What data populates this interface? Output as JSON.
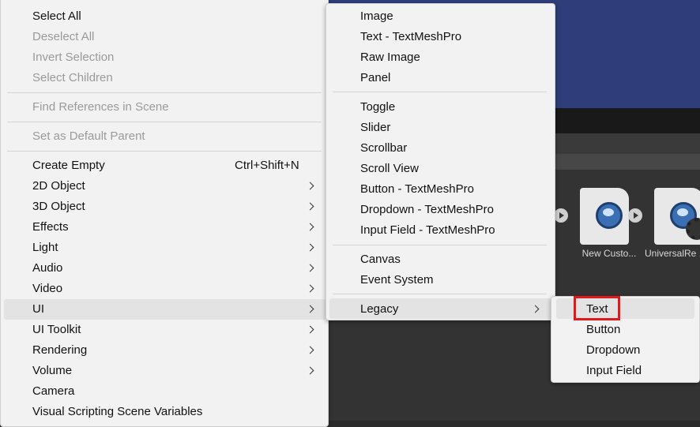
{
  "background": {
    "assets": [
      {
        "name": "New Custo...",
        "icon": "custom-render-asset-icon"
      },
      {
        "name": "UniversalRe",
        "icon": "universal-render-settings-icon"
      }
    ]
  },
  "context_menu": {
    "items": [
      {
        "label": "Select All",
        "enabled": true
      },
      {
        "label": "Deselect All",
        "enabled": false
      },
      {
        "label": "Invert Selection",
        "enabled": false
      },
      {
        "label": "Select Children",
        "enabled": false
      },
      {
        "label": "Find References in Scene",
        "enabled": false
      },
      {
        "label": "Set as Default Parent",
        "enabled": false
      },
      {
        "label": "Create Empty",
        "shortcut": "Ctrl+Shift+N",
        "enabled": true
      },
      {
        "label": "2D Object",
        "submenu": true
      },
      {
        "label": "3D Object",
        "submenu": true
      },
      {
        "label": "Effects",
        "submenu": true
      },
      {
        "label": "Light",
        "submenu": true
      },
      {
        "label": "Audio",
        "submenu": true
      },
      {
        "label": "Video",
        "submenu": true
      },
      {
        "label": "UI",
        "submenu": true,
        "highlighted": true
      },
      {
        "label": "UI Toolkit",
        "submenu": true
      },
      {
        "label": "Rendering",
        "submenu": true
      },
      {
        "label": "Volume",
        "submenu": true
      },
      {
        "label": "Camera"
      },
      {
        "label": "Visual Scripting Scene Variables"
      }
    ]
  },
  "ui_submenu": {
    "items": [
      {
        "label": "Image"
      },
      {
        "label": "Text - TextMeshPro"
      },
      {
        "label": "Raw Image"
      },
      {
        "label": "Panel"
      },
      {
        "label": "Toggle"
      },
      {
        "label": "Slider"
      },
      {
        "label": "Scrollbar"
      },
      {
        "label": "Scroll View"
      },
      {
        "label": "Button - TextMeshPro"
      },
      {
        "label": "Dropdown - TextMeshPro"
      },
      {
        "label": "Input Field - TextMeshPro"
      },
      {
        "label": "Canvas"
      },
      {
        "label": "Event System"
      },
      {
        "label": "Legacy",
        "submenu": true,
        "highlighted": true
      }
    ]
  },
  "legacy_submenu": {
    "items": [
      {
        "label": "Text",
        "highlighted": true,
        "annotated": true
      },
      {
        "label": "Button"
      },
      {
        "label": "Dropdown"
      },
      {
        "label": "Input Field"
      }
    ]
  },
  "colors": {
    "menu_bg": "#f2f2f2",
    "highlight": "#e3e3e3",
    "disabled_text": "#9a9a9a",
    "annotation_red": "#e0191d",
    "scene_blue": "#2f3d7a"
  }
}
